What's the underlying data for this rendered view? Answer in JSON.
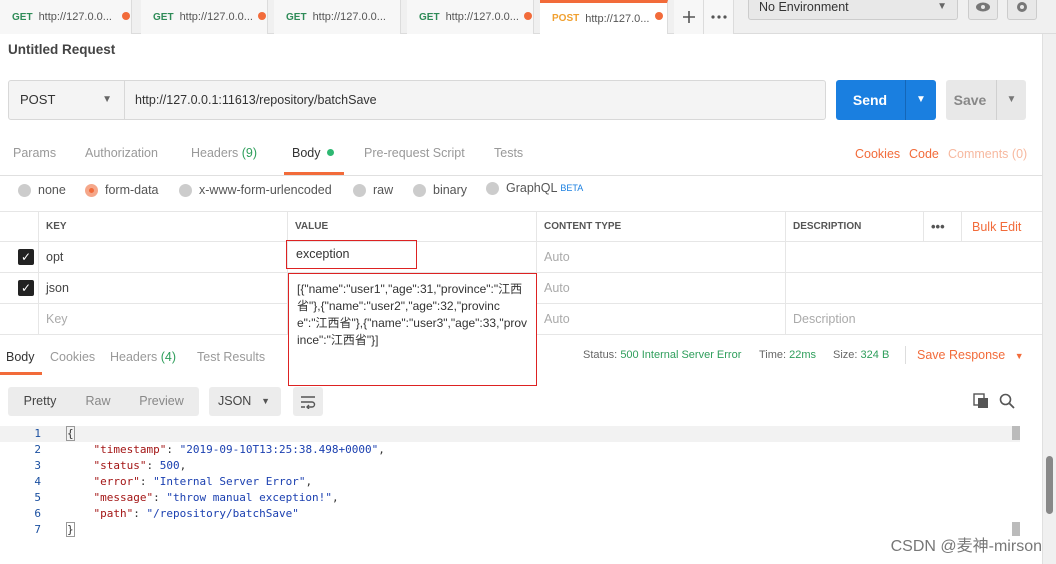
{
  "tabs": [
    {
      "method": "GET",
      "url": "http://127.0.0..."
    },
    {
      "method": "GET",
      "url": "http://127.0.0..."
    },
    {
      "method": "GET",
      "url": "http://127.0.0..."
    },
    {
      "method": "GET",
      "url": "http://127.0.0..."
    },
    {
      "method": "POST",
      "url": "http://127.0..."
    }
  ],
  "environment": "No Environment",
  "request_title": "Untitled Request",
  "request": {
    "method": "POST",
    "url": "http://127.0.0.1:11613/repository/batchSave",
    "send_label": "Send",
    "save_label": "Save"
  },
  "req_tabs": {
    "params": "Params",
    "authorization": "Authorization",
    "headers": "Headers",
    "headers_count": "(9)",
    "body": "Body",
    "prerequest": "Pre-request Script",
    "tests": "Tests",
    "cookies": "Cookies",
    "code": "Code",
    "comments": "Comments (0)"
  },
  "body_modes": {
    "none": "none",
    "form_data": "form-data",
    "urlencoded": "x-www-form-urlencoded",
    "raw": "raw",
    "binary": "binary",
    "graphql": "GraphQL",
    "graphql_badge": "BETA"
  },
  "table": {
    "headers": {
      "key": "KEY",
      "value": "VALUE",
      "content_type": "CONTENT TYPE",
      "description": "DESCRIPTION",
      "more": "•••",
      "bulk_edit": "Bulk Edit"
    },
    "rows": [
      {
        "key": "opt",
        "value": "exception",
        "content_type": "Auto"
      },
      {
        "key": "json",
        "value": "",
        "content_type": "Auto"
      }
    ],
    "empty_row": {
      "key": "Key",
      "content_type": "Auto",
      "description": "Description"
    },
    "json_value": "[{\"name\":\"user1\",\"age\":31,\"province\":\"江西省\"},{\"name\":\"user2\",\"age\":32,\"province\":\"江西省\"},{\"name\":\"user3\",\"age\":33,\"province\":\"江西省\"}]"
  },
  "response": {
    "tabs": {
      "body": "Body",
      "cookies": "Cookies",
      "headers": "Headers",
      "headers_count": "(4)",
      "test_results": "Test Results"
    },
    "status_label": "Status:",
    "status_value": "500 Internal Server Error",
    "time_label": "Time:",
    "time_value": "22ms",
    "size_label": "Size:",
    "size_value": "324 B",
    "save_response": "Save Response",
    "view_modes": {
      "pretty": "Pretty",
      "raw": "Raw",
      "preview": "Preview"
    },
    "format": "JSON",
    "line_numbers": [
      "1",
      "2",
      "3",
      "4",
      "5",
      "6",
      "7"
    ],
    "json": {
      "timestamp": "2019-09-10T13:25:38.498+0000",
      "status": "500",
      "error": "Internal Server Error",
      "message": "throw manual exception!",
      "path": "/repository/batchSave"
    }
  },
  "watermark": "CSDN @麦神-mirson",
  "colors": {
    "accent": "#f26b3a",
    "send": "#1a7fe0",
    "status_ok": "#2e9e5b"
  }
}
